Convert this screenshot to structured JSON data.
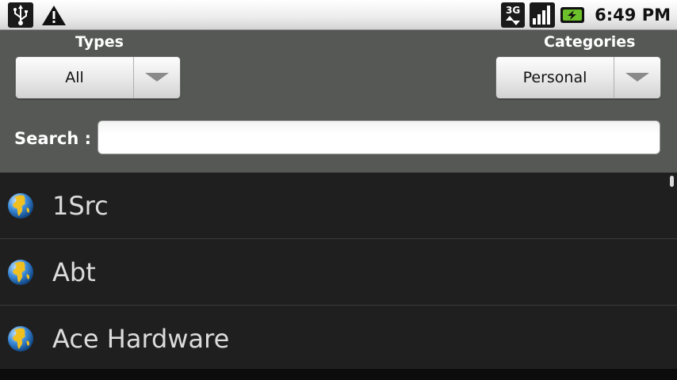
{
  "status_bar": {
    "time": "6:49 PM",
    "network_type": "3G",
    "icons": [
      "usb-icon",
      "warning-icon",
      "network-3g-icon",
      "signal-icon",
      "battery-charging-icon"
    ]
  },
  "filters": {
    "types_label": "Types",
    "types_value": "All",
    "categories_label": "Categories",
    "categories_value": "Personal",
    "search_label": "Search :",
    "search_value": "",
    "search_placeholder": ""
  },
  "list": {
    "items": [
      {
        "name": "1Src",
        "icon": "globe-icon"
      },
      {
        "name": "Abt",
        "icon": "globe-icon"
      },
      {
        "name": "Ace Hardware",
        "icon": "globe-icon"
      }
    ]
  },
  "colors": {
    "panel_bg": "#555855",
    "list_bg": "#1f1f1f",
    "item_text": "#dcdcdc",
    "battery_accent": "#6cc02a"
  }
}
